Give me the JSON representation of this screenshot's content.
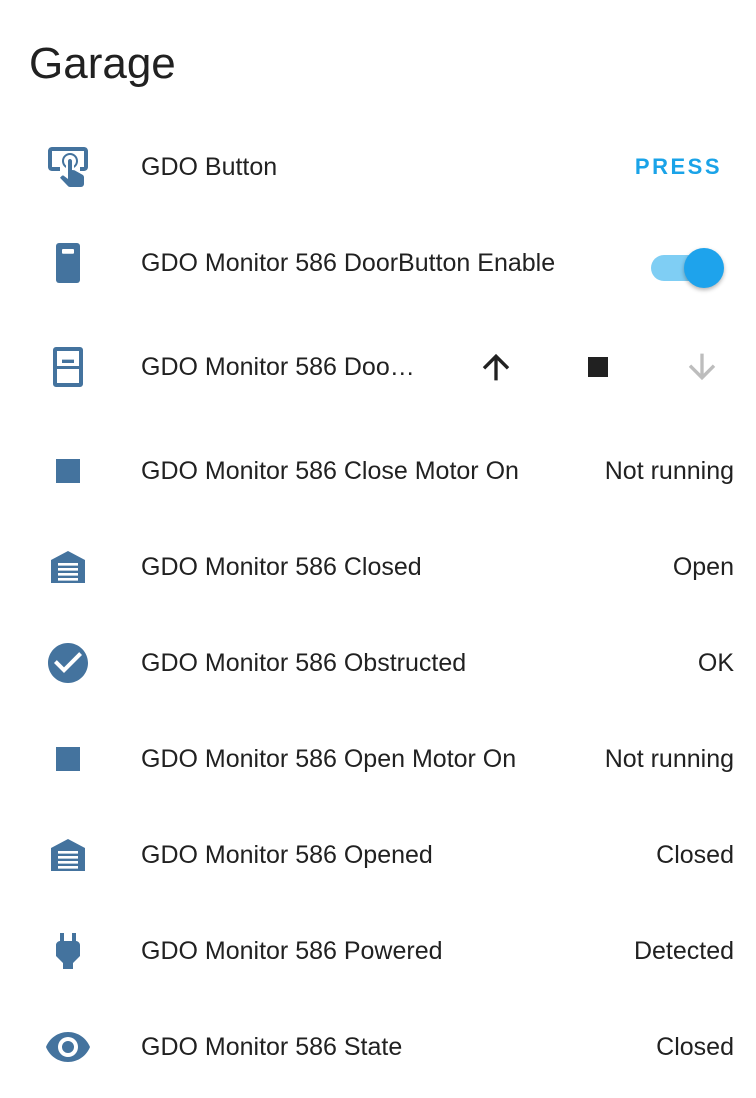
{
  "card": {
    "title": "Garage"
  },
  "colors": {
    "icon": "#44739e",
    "accent": "#1aa3e8",
    "text": "#212121",
    "disabled": "#bdbdbd"
  },
  "rows": [
    {
      "name": "GDO Button",
      "icon": "gesture-tap-button-icon",
      "action": "PRESS"
    },
    {
      "name": "GDO Monitor 586 DoorButton Enable",
      "icon": "door-button-icon",
      "toggle_on": true
    },
    {
      "name": "GDO Monitor 586 Doo…",
      "icon": "garage-door-control-icon",
      "controls": [
        "open-arrow-up",
        "stop-square",
        "close-arrow-down-disabled"
      ]
    },
    {
      "name": "GDO Monitor 586 Close Motor On",
      "icon": "square-icon",
      "state": "Not running"
    },
    {
      "name": "GDO Monitor 586 Closed",
      "icon": "garage-icon",
      "state": "Open"
    },
    {
      "name": "GDO Monitor 586 Obstructed",
      "icon": "check-circle-icon",
      "state": "OK"
    },
    {
      "name": "GDO Monitor 586 Open Motor On",
      "icon": "square-icon",
      "state": "Not running"
    },
    {
      "name": "GDO Monitor 586 Opened",
      "icon": "garage-icon",
      "state": "Closed"
    },
    {
      "name": "GDO Monitor 586 Powered",
      "icon": "power-plug-icon",
      "state": "Detected"
    },
    {
      "name": "GDO Monitor 586 State",
      "icon": "eye-icon",
      "state": "Closed"
    }
  ]
}
